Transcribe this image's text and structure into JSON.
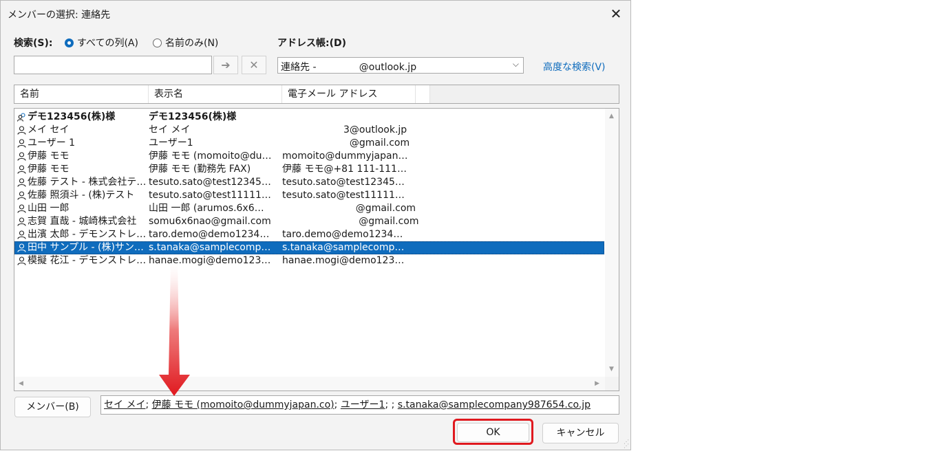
{
  "dialog": {
    "title": "メンバーの選択: 連絡先",
    "close_glyph": "✕"
  },
  "search": {
    "label": "検索(S):",
    "radio_all": "すべての列(A)",
    "radio_name": "名前のみ(N)",
    "input_value": "",
    "go_glyph": "➔",
    "clear_glyph": "✕"
  },
  "address_book": {
    "label": "アドレス帳:(D)",
    "selected": "連絡先 -              @outlook.jp",
    "chevron": "⌵",
    "advanced_link": "高度な検索(V)"
  },
  "columns": [
    "名前",
    "表示名",
    "電子メール アドレス"
  ],
  "rows": [
    {
      "name": "デモ123456(株)様",
      "display": "デモ123456(株)様",
      "email": "",
      "icon": "group-person-icon",
      "bold": true
    },
    {
      "name": "メイ セイ",
      "display": "セイ メイ",
      "email": "                    3@outlook.jp",
      "icon": "person-icon"
    },
    {
      "name": "ユーザー 1",
      "display": "ユーザー1",
      "email": "                      @gmail.com",
      "icon": "person-icon"
    },
    {
      "name": "伊藤 モモ",
      "display": "伊藤 モモ (momoito@du…",
      "email": "momoito@dummyjapan…",
      "icon": "person-icon"
    },
    {
      "name": "伊藤 モモ",
      "display": "伊藤 モモ (勤務先 FAX)",
      "email": "伊藤 モモ@+81 111-111…",
      "icon": "person-icon"
    },
    {
      "name": "佐藤 テスト - 株式会社テ…",
      "display": "tesuto.sato@test12345…",
      "email": "tesuto.sato@test12345…",
      "icon": "person-icon"
    },
    {
      "name": "佐藤 照須斗 - (株)テスト",
      "display": "tesuto.sato@test11111…",
      "email": "tesuto.sato@test11111…",
      "icon": "person-icon"
    },
    {
      "name": "山田 一郎",
      "display": "山田 一郎 (arumos.6x6…",
      "email": "                        @gmail.com",
      "icon": "person-icon"
    },
    {
      "name": "志賀 直哉 - 城崎株式会社",
      "display": "somu6x6nao@gmail.com",
      "email": "                         @gmail.com",
      "icon": "person-icon"
    },
    {
      "name": "出濱 太郎 - デモンストレ…",
      "display": "taro.demo@demo1234…",
      "email": "taro.demo@demo1234…",
      "icon": "person-icon"
    },
    {
      "name": "田中 サンプル - (株)サン…",
      "display": "s.tanaka@samplecomp…",
      "email": "s.tanaka@samplecomp…",
      "icon": "person-icon",
      "selected": true
    },
    {
      "name": "模擬 花江 - デモンストレ…",
      "display": "hanae.mogi@demo123…",
      "email": "hanae.mogi@demo123…",
      "icon": "person-icon"
    }
  ],
  "scroll": {
    "up": "▲",
    "down": "▼",
    "left": "◀",
    "right": "▶"
  },
  "members": {
    "button": "メンバー(B)",
    "items": [
      "セイ メイ",
      "伊藤 モモ (momoito@dummyjapan.co)",
      "ユーザー1",
      "",
      "s.tanaka@samplecompany987654.co.jp"
    ]
  },
  "footer": {
    "ok": "OK",
    "cancel": "キャンセル"
  },
  "colors": {
    "accent": "#0f6cbd",
    "highlight": "#e0191f"
  }
}
